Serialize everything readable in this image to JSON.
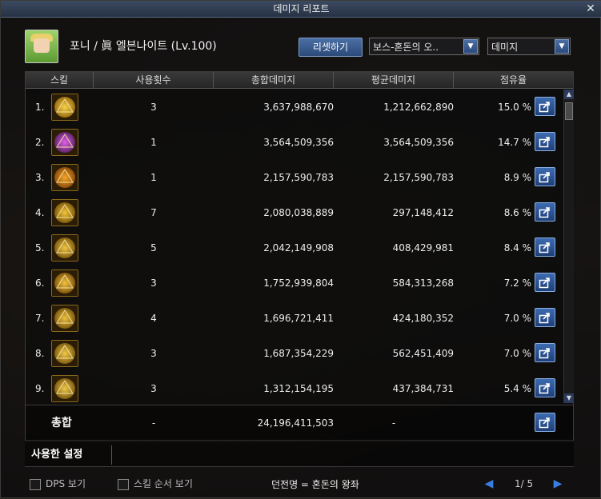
{
  "window": {
    "title": "데미지 리포트",
    "close_glyph": "✕"
  },
  "character": {
    "name": "포니 / 眞 엘븐나이트 (Lv.100)"
  },
  "controls": {
    "reset_label": "리셋하기",
    "target_select": "보스-혼돈의 오..",
    "metric_select": "데미지"
  },
  "columns": [
    "스킬",
    "사용횟수",
    "총합데미지",
    "평균데미지",
    "점유율"
  ],
  "rows": [
    {
      "rank": "1.",
      "icon": "skill-1-icon",
      "count": "3",
      "total": "3,637,988,670",
      "avg": "1,212,662,890",
      "share": "15.0 %"
    },
    {
      "rank": "2.",
      "icon": "skill-2-icon",
      "count": "1",
      "total": "3,564,509,356",
      "avg": "3,564,509,356",
      "share": "14.7 %"
    },
    {
      "rank": "3.",
      "icon": "skill-3-icon",
      "count": "1",
      "total": "2,157,590,783",
      "avg": "2,157,590,783",
      "share": "8.9 %"
    },
    {
      "rank": "4.",
      "icon": "skill-4-icon",
      "count": "7",
      "total": "2,080,038,889",
      "avg": "297,148,412",
      "share": "8.6 %"
    },
    {
      "rank": "5.",
      "icon": "skill-5-icon",
      "count": "5",
      "total": "2,042,149,908",
      "avg": "408,429,981",
      "share": "8.4 %"
    },
    {
      "rank": "6.",
      "icon": "skill-6-icon",
      "count": "3",
      "total": "1,752,939,804",
      "avg": "584,313,268",
      "share": "7.2 %"
    },
    {
      "rank": "7.",
      "icon": "skill-7-icon",
      "count": "4",
      "total": "1,696,721,411",
      "avg": "424,180,352",
      "share": "7.0 %"
    },
    {
      "rank": "8.",
      "icon": "skill-8-icon",
      "count": "3",
      "total": "1,687,354,229",
      "avg": "562,451,409",
      "share": "7.0 %"
    },
    {
      "rank": "9.",
      "icon": "skill-9-icon",
      "count": "3",
      "total": "1,312,154,195",
      "avg": "437,384,731",
      "share": "5.4 %"
    }
  ],
  "summary": {
    "label": "총합",
    "count": "-",
    "total": "24,196,411,503",
    "avg": "-"
  },
  "settings": {
    "tab_label": "사용한 설정"
  },
  "footer": {
    "dps_label": "DPS 보기",
    "skill_order_label": "스킬 순서 보기",
    "dungeon_text": "던전명 = 혼돈의 왕좌",
    "page_text": "1/ 5"
  },
  "colors": {
    "accent": "#2c4a7b",
    "gold": "#d6a21c"
  }
}
